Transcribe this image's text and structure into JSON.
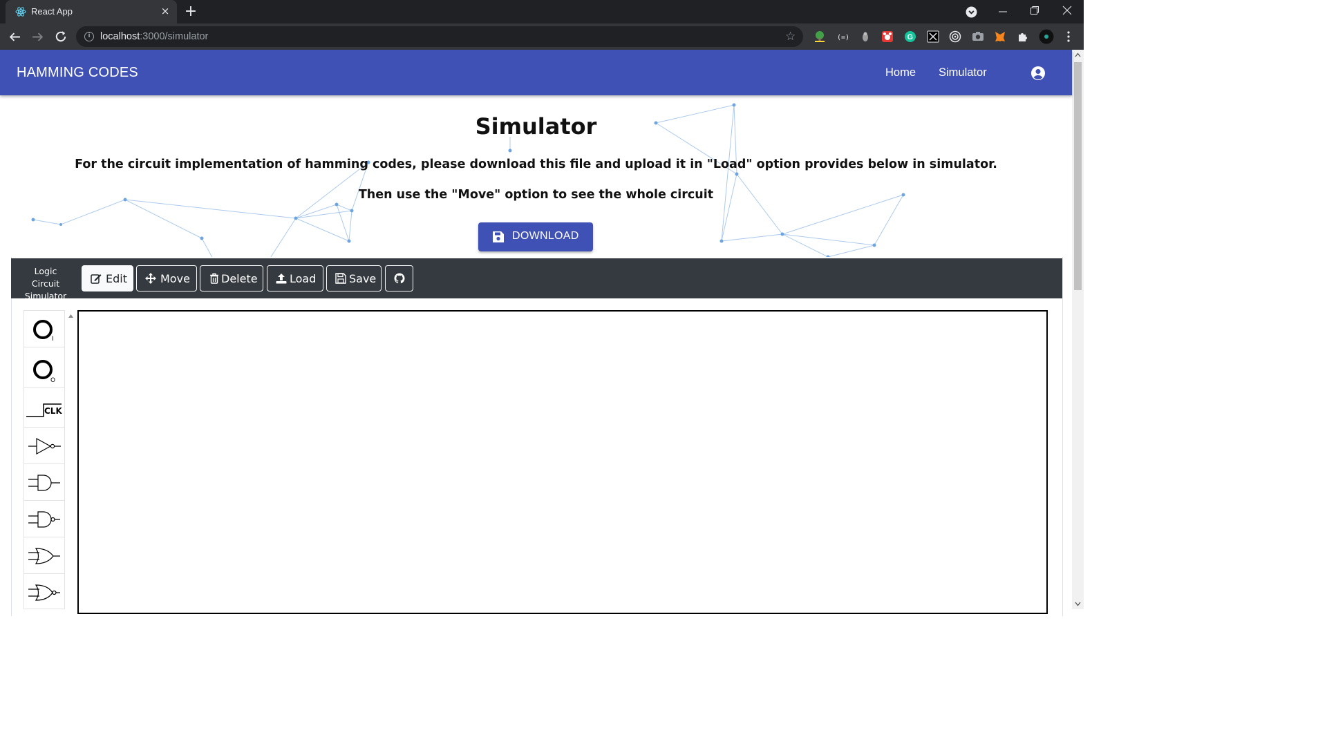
{
  "browser": {
    "tab_title": "React App",
    "tab_close": "×",
    "new_tab": "+",
    "url_host": "localhost",
    "url_path": ":3000/simulator",
    "colors": {
      "tabstrip": "#202124",
      "toolbar": "#35363a"
    }
  },
  "app": {
    "brand": "HAMMING CODES",
    "nav": {
      "home": "Home",
      "simulator": "Simulator"
    },
    "colors": {
      "primary": "#3f51b5",
      "sim_bar": "#343a40"
    }
  },
  "content": {
    "heading": "Simulator",
    "instruction_1": "For the circuit implementation of hamming codes, please download this file and upload it in \"Load\" option provides below in simulator.",
    "instruction_2": "Then use the \"Move\" option to see the whole circuit",
    "download_label": "DOWNLOAD"
  },
  "simulator": {
    "brand_line1": "Logic Circuit",
    "brand_line2": "Simulator",
    "buttons": {
      "edit": "Edit",
      "move": "Move",
      "delete": "Delete",
      "load": "Load",
      "save": "Save"
    },
    "active_mode": "edit",
    "palette": {
      "input_sub": "I",
      "output_sub": "O",
      "clock_label": "CLK",
      "items": [
        "input-icon",
        "output-icon",
        "clock-icon",
        "not-gate-icon",
        "and-gate-icon",
        "nand-gate-icon",
        "or-gate-icon",
        "nor-gate-icon"
      ]
    }
  }
}
